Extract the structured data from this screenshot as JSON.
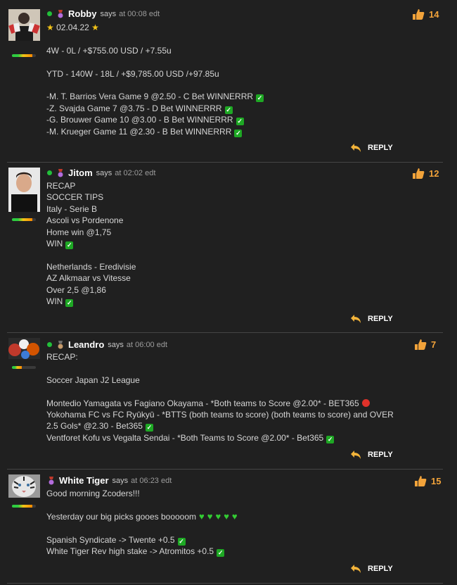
{
  "thread": [
    {
      "author": "Robby",
      "says": "says",
      "time": "at 00:08 edt",
      "likes": "14",
      "reply_label": "REPLY",
      "rank_level": 0.85,
      "medal": "purple-medal",
      "date_line": "02.04.22",
      "lines": [
        "4W - 0L / +$755.00 USD / +7.55u",
        "YTD - 140W - 18L / +$9,785.00 USD /+97.85u",
        "-M. T. Barrios Vera Game 9 @2.50 - C Bet WINNERRR",
        "-Z. Svajda Game 7 @3.75 - D Bet WINNERRR",
        "-G. Brouwer Game 10 @3.00 - B Bet WINNERRR",
        "-M. Krueger Game 11 @2.30 - B Bet WINNERRR"
      ]
    },
    {
      "author": "Jitom",
      "says": "says",
      "time": "at 02:02 edt",
      "likes": "12",
      "reply_label": "REPLY",
      "rank_level": 0.85,
      "medal": "purple-medal",
      "lines": [
        "RECAP",
        "SOCCER TIPS",
        "Italy - Serie B",
        "Ascoli vs Pordenone",
        "Home win @1,75",
        "WIN",
        "Netherlands - Eredivisie",
        "AZ Alkmaar vs Vitesse",
        "Over 2,5 @1,86",
        "WIN"
      ]
    },
    {
      "author": "Leandro",
      "says": "says",
      "time": "at 06:00 edt",
      "likes": "7",
      "reply_label": "REPLY",
      "rank_level": 0.4,
      "medal": "bronze-medal",
      "lines": [
        "RECAP:",
        "Soccer Japan J2 League",
        "Montedio Yamagata vs Fagiano Okayama - *Both teams to Score @2.00* - BET365",
        "Yokohama FC vs FC Ryūkyū - *BTTS (both teams to score) (both teams to score) and OVER 2.5 Gols* @2.30 - Bet365",
        "Ventforet Kofu vs Vegalta Sendai - *Both Teams to Score @2.00* - Bet365"
      ]
    },
    {
      "author": "White Tiger",
      "says": "says",
      "time": "at 06:23 edt",
      "likes": "15",
      "reply_label": "REPLY",
      "rank_level": 0.85,
      "medal": "purple-medal",
      "lines": [
        "Good morning Zcoders!!!",
        "Yesterday our big picks gooes booooom",
        "Spanish Syndicate -> Twente +0.5",
        "White Tiger Rev high stake -> Atromitos +0.5"
      ]
    }
  ],
  "colors": {
    "background": "#202020",
    "accent": "#f2a33a",
    "online": "#22c03a",
    "check": "#1ea824",
    "lose": "#e0322a"
  },
  "icons": [
    "thumbs-up-icon",
    "reply-arrow-icon",
    "check-icon",
    "medal-icon",
    "green-heart-icon",
    "star-icon"
  ]
}
